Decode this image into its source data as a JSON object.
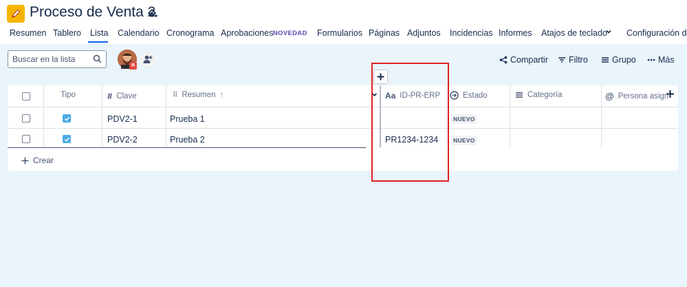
{
  "project": {
    "title": "Proceso de Venta 2",
    "icon": "pencil-icon"
  },
  "tabs": [
    {
      "label": "Resumen"
    },
    {
      "label": "Tablero"
    },
    {
      "label": "Lista",
      "active": true
    },
    {
      "label": "Calendario"
    },
    {
      "label": "Cronograma"
    },
    {
      "label": "Aprobaciones",
      "badge": "NOVEDAD"
    },
    {
      "label": "Formularios"
    },
    {
      "label": "Páginas"
    },
    {
      "label": "Adjuntos"
    },
    {
      "label": "Incidencias"
    },
    {
      "label": "Informes"
    },
    {
      "label": "Atajos de teclado"
    },
    {
      "label": "Configuración de"
    }
  ],
  "search": {
    "placeholder": "Buscar en la lista"
  },
  "avatar_badge": "R",
  "toolbar": {
    "share": "Compartir",
    "filter": "Filtro",
    "group": "Grupo",
    "more": "Más"
  },
  "columns": {
    "type": "Tipo",
    "key": "Clave",
    "summary": "Resumen",
    "erp": "ID-PR-ERP",
    "status": "Estado",
    "category": "Categoría",
    "assignee": "Persona asign"
  },
  "rows": [
    {
      "key": "PDV2-1",
      "summary": "Prueba 1",
      "erp": "",
      "status": "NUEVO"
    },
    {
      "key": "PDV2-2",
      "summary": "Prueba 2",
      "erp": "PR1234-1234",
      "status": "NUEVO"
    }
  ],
  "create_label": "Crear",
  "colors": {
    "accent": "#0c66e4",
    "highlight": "#e02020",
    "page_bg": "#e9f4fb"
  }
}
